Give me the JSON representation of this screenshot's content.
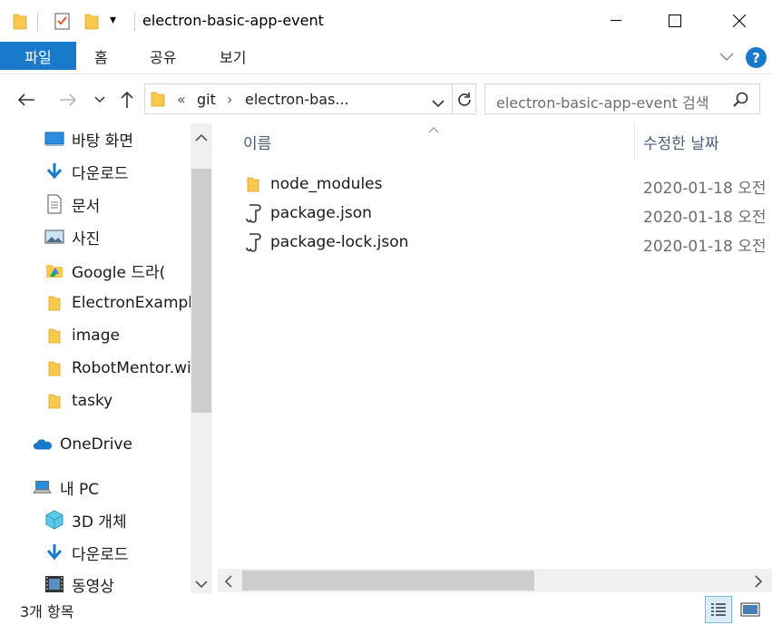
{
  "window": {
    "title": "electron-basic-app-event",
    "minimize_glyph": "—",
    "maximize_glyph": "☐",
    "close_glyph": "✕"
  },
  "quick_access_toolbar": {
    "dropdown_glyph": "▾"
  },
  "ribbon": {
    "tabs": [
      {
        "label": "파일",
        "active": true
      },
      {
        "label": "홈"
      },
      {
        "label": "공유"
      },
      {
        "label": "보기"
      }
    ],
    "expand_glyph": "⌄",
    "help_label": "?"
  },
  "address": {
    "back_glyph": "←",
    "forward_glyph": "→",
    "recent_glyph": "⌄",
    "up_glyph": "↑",
    "overflow_glyph": "«",
    "crumbs": [
      "git",
      "electron-bas..."
    ],
    "crumb_sep": "›",
    "dropdown_glyph": "⌄",
    "refresh_glyph": "↻"
  },
  "search": {
    "placeholder": "electron-basic-app-event 검색"
  },
  "nav_pane": {
    "items": [
      {
        "label": "바탕 화면",
        "icon": "desktop-icon",
        "pinned": true
      },
      {
        "label": "다운로드",
        "icon": "download-arrow-icon",
        "pinned": true
      },
      {
        "label": "문서",
        "icon": "document-icon",
        "pinned": true
      },
      {
        "label": "사진",
        "icon": "pictures-icon",
        "pinned": true
      },
      {
        "label": "Google 드라(",
        "icon": "google-drive-icon",
        "pinned": true
      },
      {
        "label": "ElectronExample",
        "icon": "folder-icon"
      },
      {
        "label": "image",
        "icon": "folder-icon"
      },
      {
        "label": "RobotMentor.wi",
        "icon": "folder-icon"
      },
      {
        "label": "tasky",
        "icon": "folder-icon"
      },
      {
        "label": "OneDrive",
        "icon": "onedrive-cloud-icon"
      },
      {
        "label": "내 PC",
        "icon": "this-pc-icon"
      },
      {
        "label": "3D 개체",
        "icon": "3d-objects-icon"
      },
      {
        "label": "다운로드",
        "icon": "download-arrow-icon"
      },
      {
        "label": "동영상",
        "icon": "video-film-icon"
      }
    ],
    "scroll_up_glyph": "⌃",
    "scroll_down_glyph": "⌄"
  },
  "file_list": {
    "columns": {
      "name": "이름",
      "modified": "수정한 날짜"
    },
    "sort_glyph": "⌃",
    "rows": [
      {
        "name": "node_modules",
        "modified": "2020-01-18 오전",
        "icon": "folder-icon"
      },
      {
        "name": "package.json",
        "modified": "2020-01-18 오전",
        "icon": "json-file-icon"
      },
      {
        "name": "package-lock.json",
        "modified": "2020-01-18 오전",
        "icon": "json-file-icon"
      }
    ],
    "hscroll_left_glyph": "‹",
    "hscroll_right_glyph": "›"
  },
  "status_bar": {
    "item_count": "3개 항목"
  },
  "colors": {
    "accent": "#1979ca",
    "folder": "#f8c94d",
    "header_text": "#4c607a",
    "date_text": "#6d6d6d",
    "scroll_track": "#f0f0f0",
    "scroll_thumb": "#cdcdcd"
  }
}
